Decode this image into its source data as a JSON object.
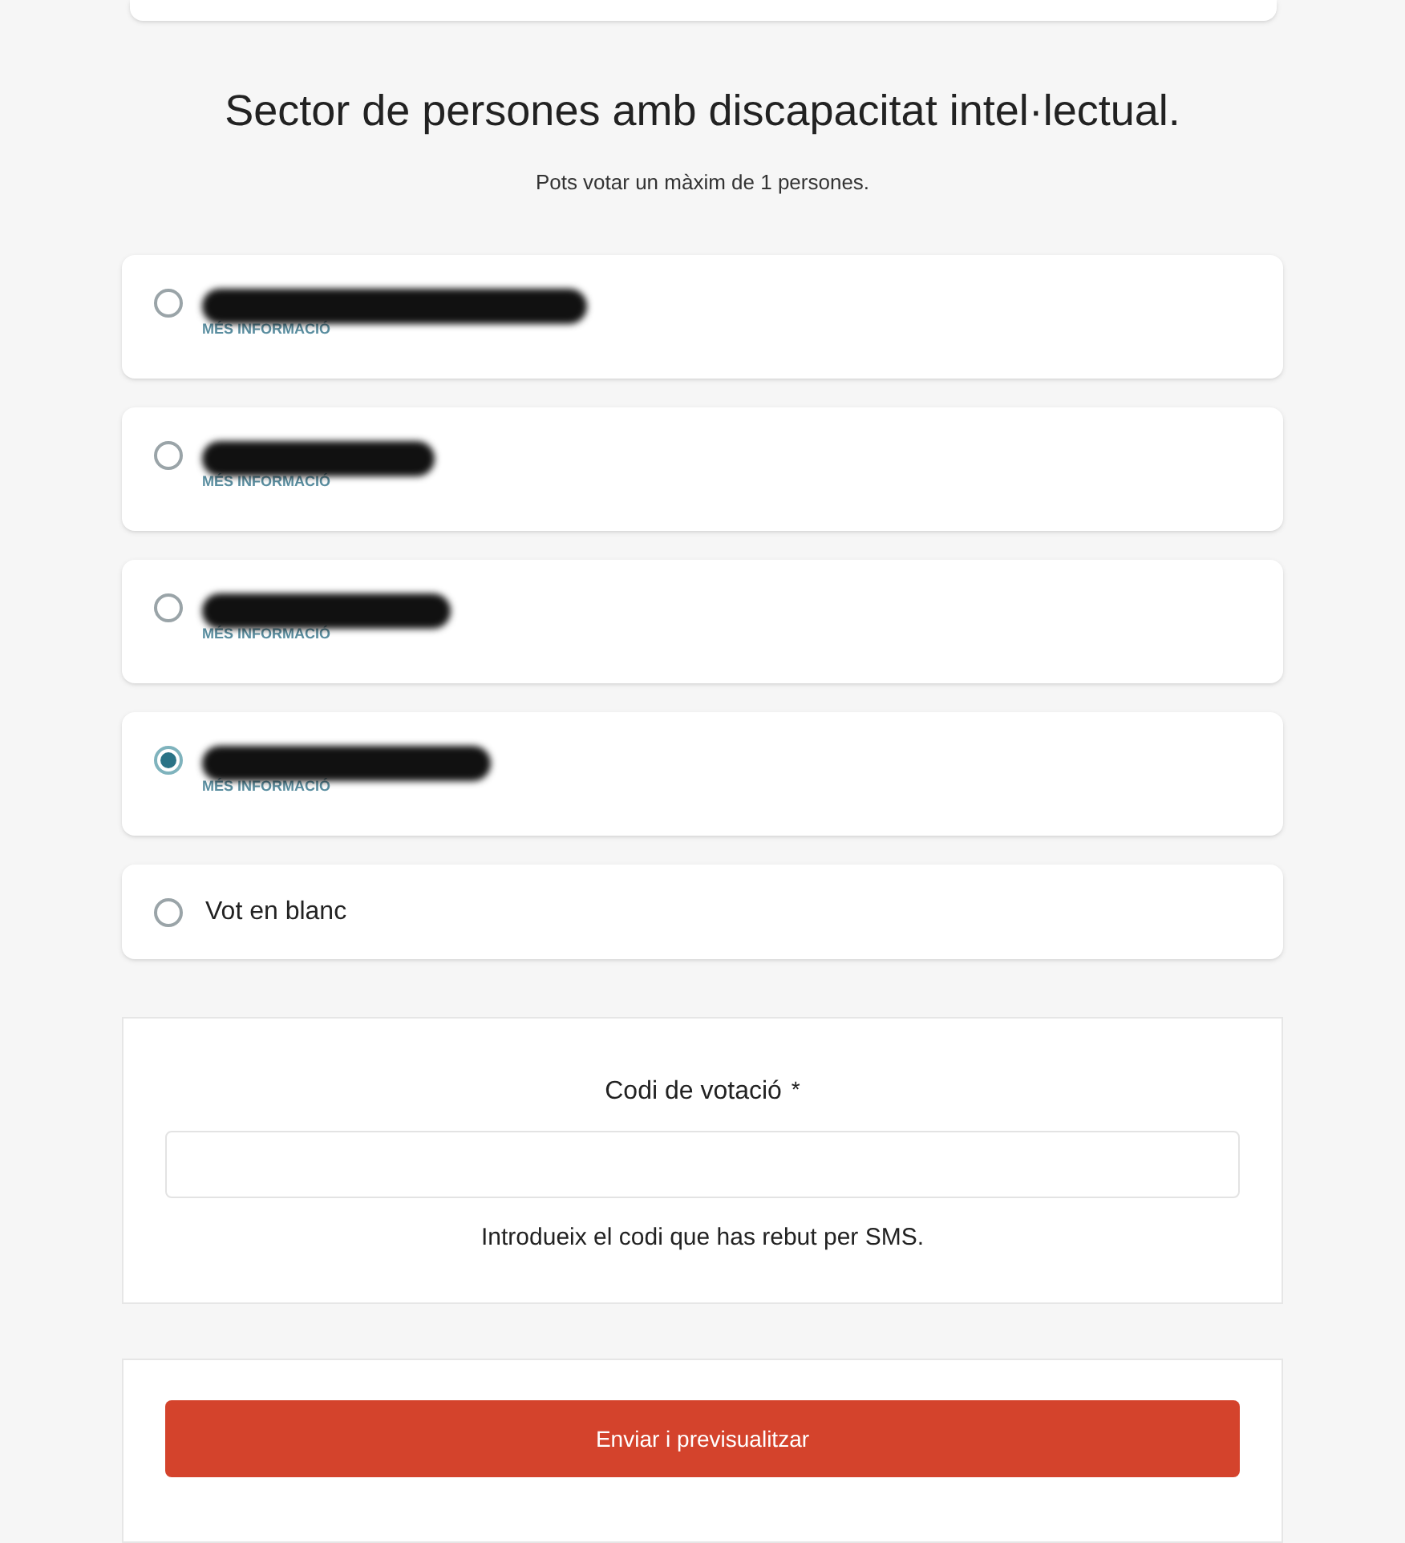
{
  "section": {
    "title": "Sector de persones amb discapacitat intel·lectual.",
    "subtitle": "Pots votar un màxim de 1 persones."
  },
  "options": [
    {
      "kind": "candidate",
      "selected": false,
      "more_info": "MÉS INFORMACIÓ"
    },
    {
      "kind": "candidate",
      "selected": false,
      "more_info": "MÉS INFORMACIÓ"
    },
    {
      "kind": "candidate",
      "selected": false,
      "more_info": "MÉS INFORMACIÓ"
    },
    {
      "kind": "candidate",
      "selected": true,
      "more_info": "MÉS INFORMACIÓ"
    },
    {
      "kind": "blank",
      "selected": false,
      "label": "Vot en blanc"
    }
  ],
  "code_field": {
    "label": "Codi de votació",
    "required_mark": "*",
    "help": "Introdueix el codi que has rebut per SMS."
  },
  "submit_button": "Enviar i previsualitzar"
}
